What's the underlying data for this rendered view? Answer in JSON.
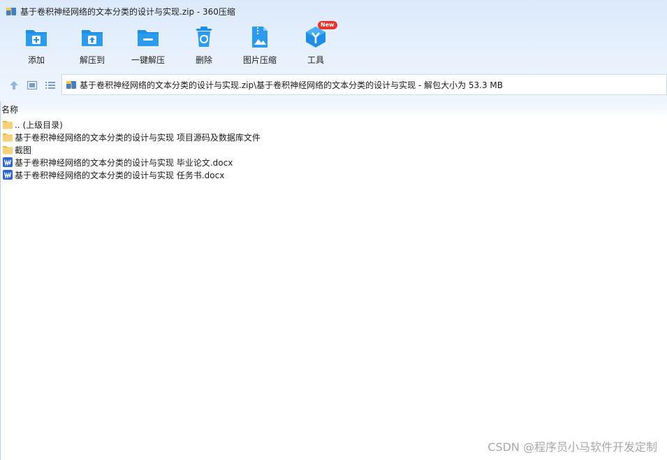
{
  "window": {
    "title": "基于卷积神经网络的文本分类的设计与实现.zip - 360压缩"
  },
  "toolbar": {
    "items": [
      {
        "label": "添加",
        "icon": "add-folder-icon"
      },
      {
        "label": "解压到",
        "icon": "extract-to-icon"
      },
      {
        "label": "一键解压",
        "icon": "one-click-extract-icon"
      },
      {
        "label": "删除",
        "icon": "recycle-delete-icon"
      },
      {
        "label": "图片压缩",
        "icon": "image-compress-icon"
      },
      {
        "label": "工具",
        "icon": "tools-cube-icon",
        "badge": "New"
      }
    ]
  },
  "address": {
    "path": "基于卷积神经网络的文本分类的设计与实现.zip\\基于卷积神经网络的文本分类的设计与实现 - 解包大小为 53.3 MB"
  },
  "list": {
    "column_name": "名称",
    "rows": [
      {
        "name": ".. (上级目录)",
        "icon": "folder-icon"
      },
      {
        "name": "基于卷积神经网络的文本分类的设计与实现 项目源码及数据库文件",
        "icon": "folder-icon"
      },
      {
        "name": "截图",
        "icon": "folder-icon"
      },
      {
        "name": "基于卷积神经网络的文本分类的设计与实现 毕业论文.docx",
        "icon": "word-doc-icon"
      },
      {
        "name": "基于卷积神经网络的文本分类的设计与实现 任务书.docx",
        "icon": "word-doc-icon"
      }
    ]
  },
  "watermark": "CSDN @程序员小马软件开发定制",
  "colors": {
    "accent": "#1e8ee8",
    "folder": "#f5d277",
    "word": "#2b64d6",
    "badge": "#e8332a"
  }
}
